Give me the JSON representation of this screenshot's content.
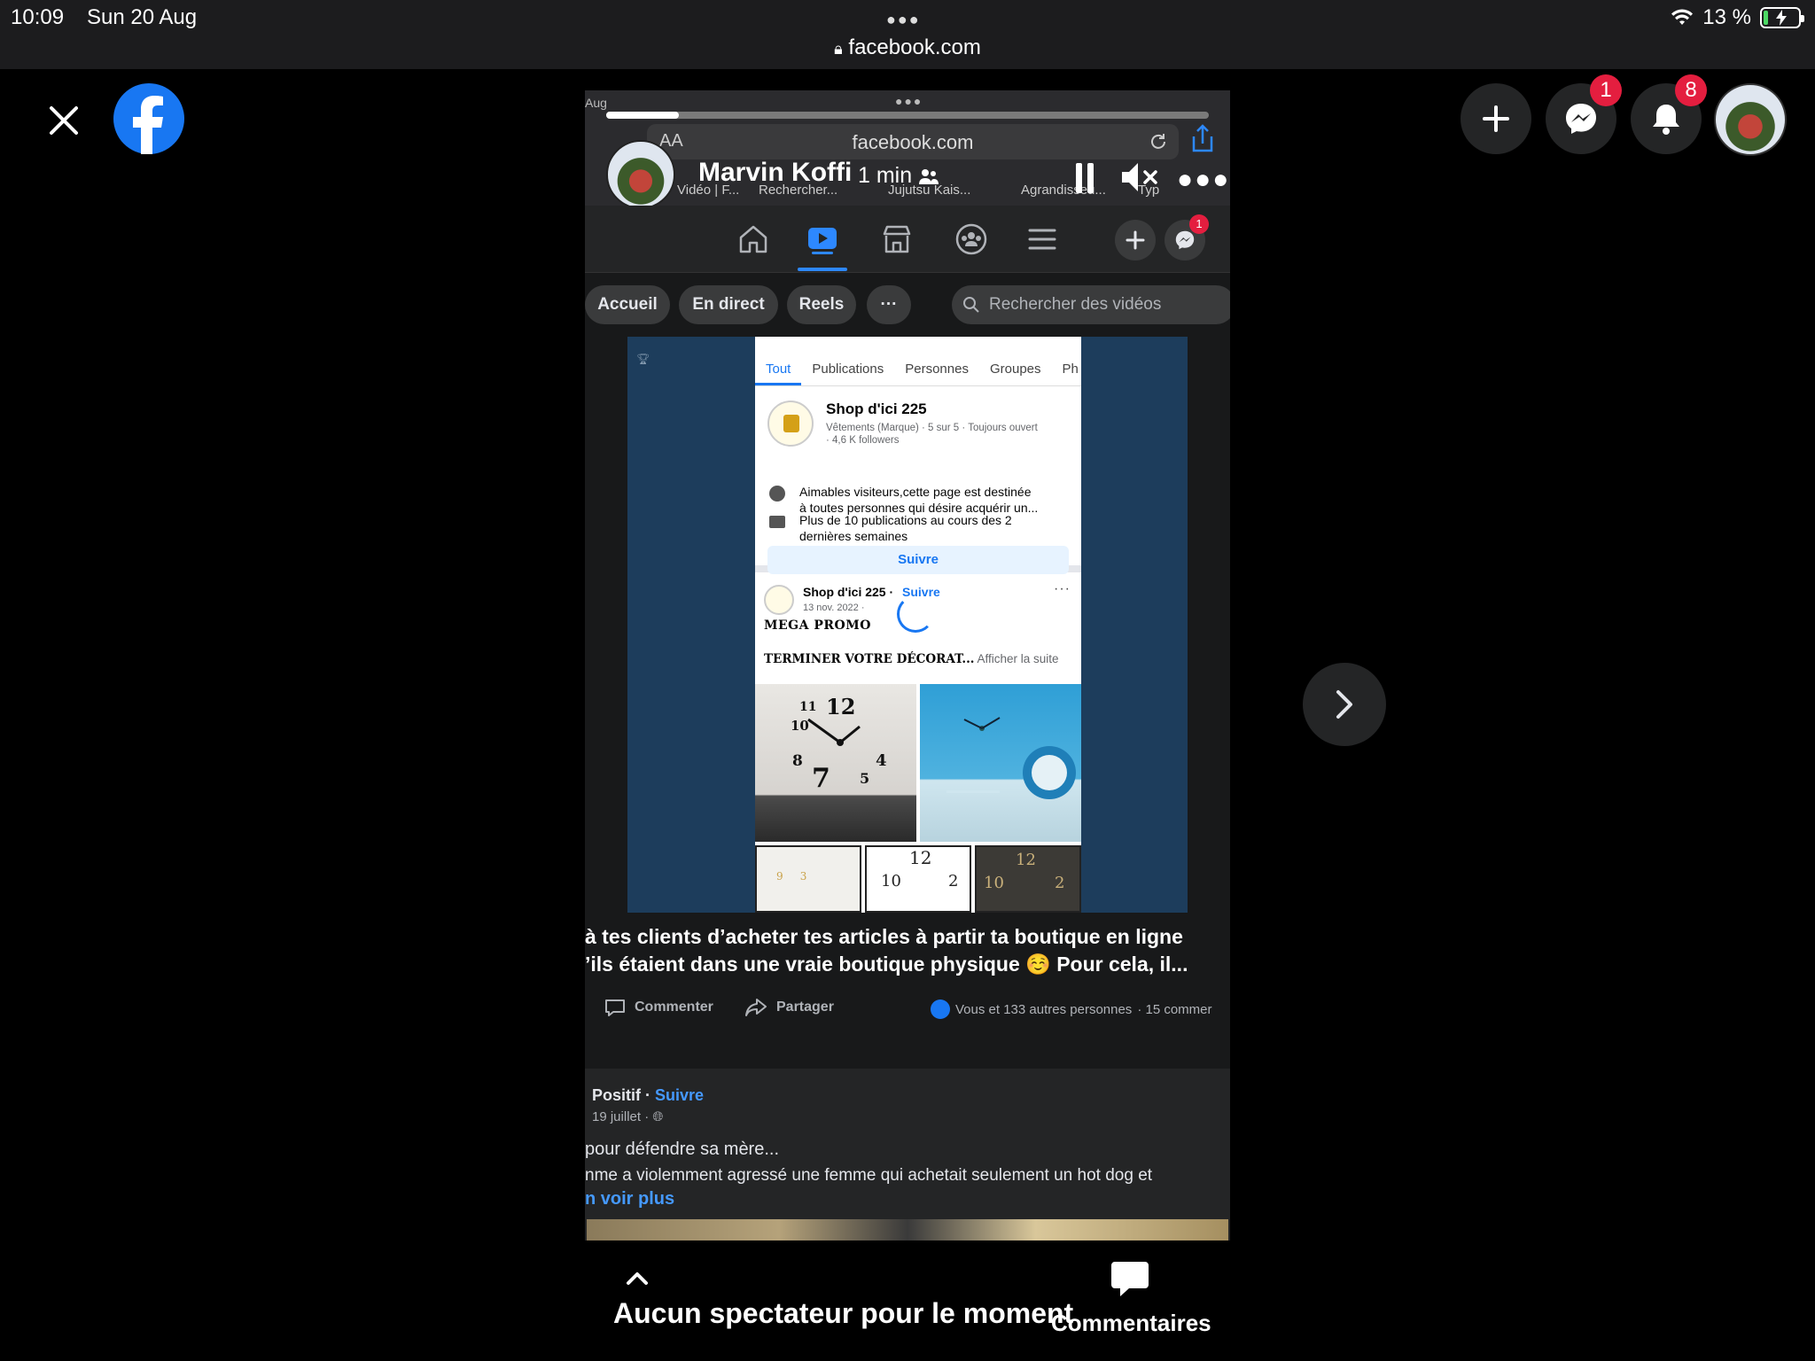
{
  "status_bar": {
    "time": "10:09",
    "date": "Sun 20 Aug",
    "url": "facebook.com",
    "battery": "13 %",
    "battery_level": 0.13,
    "charging": true
  },
  "overlay": {
    "messenger_badge": "1",
    "notifications_badge": "8"
  },
  "video": {
    "topbar_date": "Aug",
    "progress": 0.12,
    "url_bar": {
      "text_size": "AA",
      "url": "facebook.com"
    },
    "author": "Marvin Koffi",
    "duration": "1 min",
    "browser_tabs": [
      "Vidéo | F...",
      "Rechercher...",
      "Jujutsu Kais...",
      "Agrandisseu...",
      "Typ"
    ],
    "nav": {
      "messenger_badge": "1"
    },
    "chips": [
      "Accueil",
      "En direct",
      "Reels",
      "···"
    ],
    "search_placeholder": "Rechercher des vidéos",
    "screen": {
      "tabs": [
        "Tout",
        "Publications",
        "Personnes",
        "Groupes",
        "Ph"
      ],
      "page_name": "Shop d'ici 225",
      "page_meta_1": "Vêtements (Marque) · 5 sur 5 · Toujours ouvert",
      "page_meta_2": "· 4,6 K followers",
      "info_1a": "Aimables visiteurs,cette page est destinée",
      "info_1b": "à toutes personnes qui désire acquérir un...",
      "info_2a": "Plus de 10 publications au cours des 2",
      "info_2b": "dernières semaines",
      "follow": "Suivre",
      "post_name": "Shop d'ici 225 ·",
      "post_follow": "Suivre",
      "post_date": "13 nov. 2022 ·",
      "post_more": "···",
      "mega": "MEGA PROMO",
      "term": "TERMINER VOTRE DÉCORAT...",
      "term_more": " Afficher la suite"
    },
    "caption_1": "à tes clients d’acheter tes articles à partir ta boutique en ligne",
    "caption_2": "’ils étaient dans une vraie boutique physique ☺️ Pour cela, il...",
    "actions": {
      "comment": "Commenter",
      "share": "Partager",
      "likes": "Vous et 133 autres personnes",
      "comments_count": "· 15 commer"
    },
    "next_post": {
      "author": "Positif ·",
      "follow": "Suivre",
      "date": "19 juillet ·",
      "title": "pour défendre sa mère...",
      "text": "nme a violemment agressé une femme qui achetait seulement un hot dog et",
      "more": "n voir plus"
    }
  },
  "bottom": {
    "viewers": "Aucun spectateur pour le moment",
    "comments": "Commentaires"
  },
  "colors": {
    "facebook_blue": "#1877f2",
    "badge_red": "#e41e3f",
    "link_blue": "#4599ff"
  }
}
